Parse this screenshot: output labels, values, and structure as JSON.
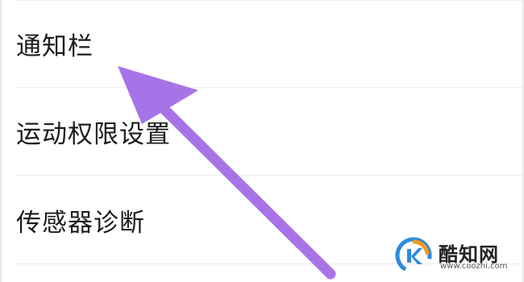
{
  "settings": {
    "items": [
      {
        "label": "通知栏"
      },
      {
        "label": "运动权限设置"
      },
      {
        "label": "传感器诊断"
      }
    ]
  },
  "annotation": {
    "arrow_color": "#a774e8",
    "points_to": "通知栏"
  },
  "watermark": {
    "name": "酷知网",
    "url": "www.coozhi.com",
    "logo_colors": [
      "#2d8ae0",
      "#f39a1e"
    ]
  }
}
